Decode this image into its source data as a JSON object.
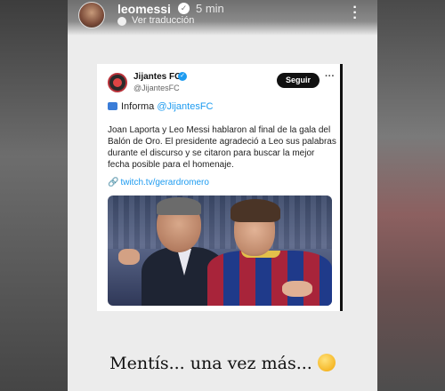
{
  "story": {
    "username": "leomessi",
    "time": "5 min",
    "translate": "Ver traducción",
    "caption": "Mentís... una vez más..."
  },
  "tweet": {
    "name": "Jijantes FC",
    "handle": "@JijantesFC",
    "follow_label": "Seguir",
    "info_prefix": "Informa",
    "info_mention": "@JijantesFC",
    "body": "Joan Laporta y Leo Messi hablaron al final de la gala del Balón de Oro. El presidente agradeció a Leo sus palabras  durante el discurso y se citaron para buscar la mejor fecha posible para el homenaje.",
    "link": "twitch.tv/gerardromero"
  },
  "icons": {
    "verified": "verified-badge-icon",
    "menu": "more-vertical-icon",
    "emoji": "thinking-face-emoji"
  },
  "colors": {
    "link": "#1d9bf0",
    "follow_bg": "#111111"
  }
}
